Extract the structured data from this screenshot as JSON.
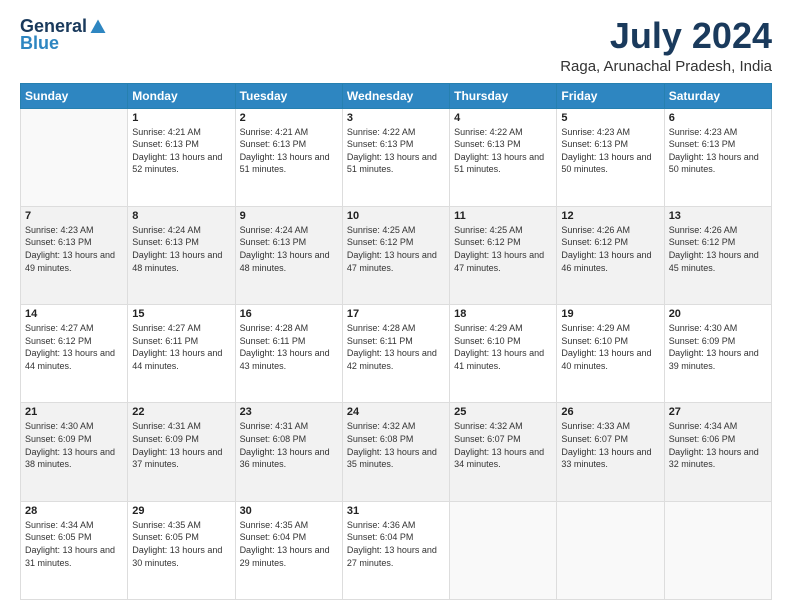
{
  "logo": {
    "general": "General",
    "blue": "Blue"
  },
  "title": "July 2024",
  "subtitle": "Raga, Arunachal Pradesh, India",
  "days_of_week": [
    "Sunday",
    "Monday",
    "Tuesday",
    "Wednesday",
    "Thursday",
    "Friday",
    "Saturday"
  ],
  "weeks": [
    [
      {
        "day": "",
        "sunrise": "",
        "sunset": "",
        "daylight": ""
      },
      {
        "day": "1",
        "sunrise": "Sunrise: 4:21 AM",
        "sunset": "Sunset: 6:13 PM",
        "daylight": "Daylight: 13 hours and 52 minutes."
      },
      {
        "day": "2",
        "sunrise": "Sunrise: 4:21 AM",
        "sunset": "Sunset: 6:13 PM",
        "daylight": "Daylight: 13 hours and 51 minutes."
      },
      {
        "day": "3",
        "sunrise": "Sunrise: 4:22 AM",
        "sunset": "Sunset: 6:13 PM",
        "daylight": "Daylight: 13 hours and 51 minutes."
      },
      {
        "day": "4",
        "sunrise": "Sunrise: 4:22 AM",
        "sunset": "Sunset: 6:13 PM",
        "daylight": "Daylight: 13 hours and 51 minutes."
      },
      {
        "day": "5",
        "sunrise": "Sunrise: 4:23 AM",
        "sunset": "Sunset: 6:13 PM",
        "daylight": "Daylight: 13 hours and 50 minutes."
      },
      {
        "day": "6",
        "sunrise": "Sunrise: 4:23 AM",
        "sunset": "Sunset: 6:13 PM",
        "daylight": "Daylight: 13 hours and 50 minutes."
      }
    ],
    [
      {
        "day": "7",
        "sunrise": "Sunrise: 4:23 AM",
        "sunset": "Sunset: 6:13 PM",
        "daylight": "Daylight: 13 hours and 49 minutes."
      },
      {
        "day": "8",
        "sunrise": "Sunrise: 4:24 AM",
        "sunset": "Sunset: 6:13 PM",
        "daylight": "Daylight: 13 hours and 48 minutes."
      },
      {
        "day": "9",
        "sunrise": "Sunrise: 4:24 AM",
        "sunset": "Sunset: 6:13 PM",
        "daylight": "Daylight: 13 hours and 48 minutes."
      },
      {
        "day": "10",
        "sunrise": "Sunrise: 4:25 AM",
        "sunset": "Sunset: 6:12 PM",
        "daylight": "Daylight: 13 hours and 47 minutes."
      },
      {
        "day": "11",
        "sunrise": "Sunrise: 4:25 AM",
        "sunset": "Sunset: 6:12 PM",
        "daylight": "Daylight: 13 hours and 47 minutes."
      },
      {
        "day": "12",
        "sunrise": "Sunrise: 4:26 AM",
        "sunset": "Sunset: 6:12 PM",
        "daylight": "Daylight: 13 hours and 46 minutes."
      },
      {
        "day": "13",
        "sunrise": "Sunrise: 4:26 AM",
        "sunset": "Sunset: 6:12 PM",
        "daylight": "Daylight: 13 hours and 45 minutes."
      }
    ],
    [
      {
        "day": "14",
        "sunrise": "Sunrise: 4:27 AM",
        "sunset": "Sunset: 6:12 PM",
        "daylight": "Daylight: 13 hours and 44 minutes."
      },
      {
        "day": "15",
        "sunrise": "Sunrise: 4:27 AM",
        "sunset": "Sunset: 6:11 PM",
        "daylight": "Daylight: 13 hours and 44 minutes."
      },
      {
        "day": "16",
        "sunrise": "Sunrise: 4:28 AM",
        "sunset": "Sunset: 6:11 PM",
        "daylight": "Daylight: 13 hours and 43 minutes."
      },
      {
        "day": "17",
        "sunrise": "Sunrise: 4:28 AM",
        "sunset": "Sunset: 6:11 PM",
        "daylight": "Daylight: 13 hours and 42 minutes."
      },
      {
        "day": "18",
        "sunrise": "Sunrise: 4:29 AM",
        "sunset": "Sunset: 6:10 PM",
        "daylight": "Daylight: 13 hours and 41 minutes."
      },
      {
        "day": "19",
        "sunrise": "Sunrise: 4:29 AM",
        "sunset": "Sunset: 6:10 PM",
        "daylight": "Daylight: 13 hours and 40 minutes."
      },
      {
        "day": "20",
        "sunrise": "Sunrise: 4:30 AM",
        "sunset": "Sunset: 6:09 PM",
        "daylight": "Daylight: 13 hours and 39 minutes."
      }
    ],
    [
      {
        "day": "21",
        "sunrise": "Sunrise: 4:30 AM",
        "sunset": "Sunset: 6:09 PM",
        "daylight": "Daylight: 13 hours and 38 minutes."
      },
      {
        "day": "22",
        "sunrise": "Sunrise: 4:31 AM",
        "sunset": "Sunset: 6:09 PM",
        "daylight": "Daylight: 13 hours and 37 minutes."
      },
      {
        "day": "23",
        "sunrise": "Sunrise: 4:31 AM",
        "sunset": "Sunset: 6:08 PM",
        "daylight": "Daylight: 13 hours and 36 minutes."
      },
      {
        "day": "24",
        "sunrise": "Sunrise: 4:32 AM",
        "sunset": "Sunset: 6:08 PM",
        "daylight": "Daylight: 13 hours and 35 minutes."
      },
      {
        "day": "25",
        "sunrise": "Sunrise: 4:32 AM",
        "sunset": "Sunset: 6:07 PM",
        "daylight": "Daylight: 13 hours and 34 minutes."
      },
      {
        "day": "26",
        "sunrise": "Sunrise: 4:33 AM",
        "sunset": "Sunset: 6:07 PM",
        "daylight": "Daylight: 13 hours and 33 minutes."
      },
      {
        "day": "27",
        "sunrise": "Sunrise: 4:34 AM",
        "sunset": "Sunset: 6:06 PM",
        "daylight": "Daylight: 13 hours and 32 minutes."
      }
    ],
    [
      {
        "day": "28",
        "sunrise": "Sunrise: 4:34 AM",
        "sunset": "Sunset: 6:05 PM",
        "daylight": "Daylight: 13 hours and 31 minutes."
      },
      {
        "day": "29",
        "sunrise": "Sunrise: 4:35 AM",
        "sunset": "Sunset: 6:05 PM",
        "daylight": "Daylight: 13 hours and 30 minutes."
      },
      {
        "day": "30",
        "sunrise": "Sunrise: 4:35 AM",
        "sunset": "Sunset: 6:04 PM",
        "daylight": "Daylight: 13 hours and 29 minutes."
      },
      {
        "day": "31",
        "sunrise": "Sunrise: 4:36 AM",
        "sunset": "Sunset: 6:04 PM",
        "daylight": "Daylight: 13 hours and 27 minutes."
      },
      {
        "day": "",
        "sunrise": "",
        "sunset": "",
        "daylight": ""
      },
      {
        "day": "",
        "sunrise": "",
        "sunset": "",
        "daylight": ""
      },
      {
        "day": "",
        "sunrise": "",
        "sunset": "",
        "daylight": ""
      }
    ]
  ]
}
